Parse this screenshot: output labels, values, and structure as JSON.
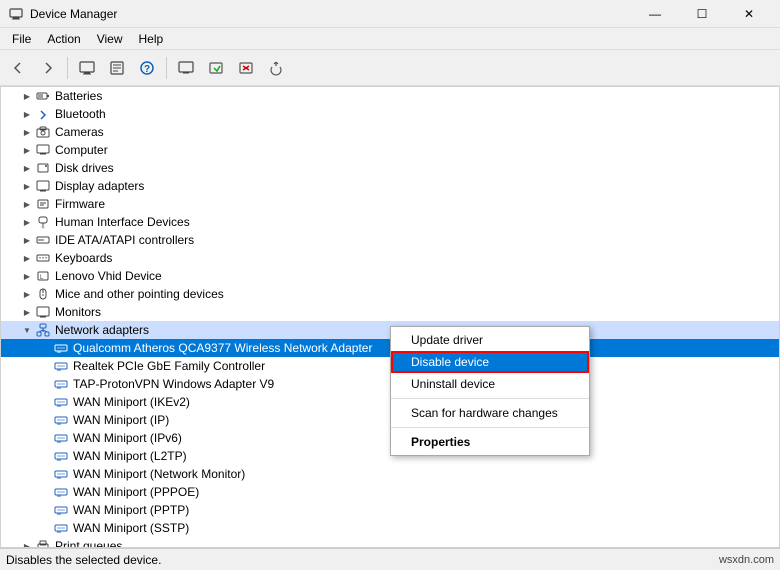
{
  "titleBar": {
    "icon": "🖥",
    "title": "Device Manager",
    "minimize": "—",
    "maximize": "☐",
    "close": "✕"
  },
  "menuBar": {
    "items": [
      "File",
      "Action",
      "View",
      "Help"
    ]
  },
  "toolbar": {
    "buttons": [
      "←",
      "→",
      "🖥",
      "📋",
      "❓",
      "🖥",
      "🔧",
      "✕",
      "⬇"
    ]
  },
  "tree": {
    "items": [
      {
        "id": "batteries",
        "label": "Batteries",
        "indent": 1,
        "expanded": false,
        "hasChildren": true,
        "icon": "battery"
      },
      {
        "id": "bluetooth",
        "label": "Bluetooth",
        "indent": 1,
        "expanded": false,
        "hasChildren": true,
        "icon": "bluetooth"
      },
      {
        "id": "cameras",
        "label": "Cameras",
        "indent": 1,
        "expanded": false,
        "hasChildren": true,
        "icon": "camera"
      },
      {
        "id": "computer",
        "label": "Computer",
        "indent": 1,
        "expanded": false,
        "hasChildren": true,
        "icon": "computer"
      },
      {
        "id": "diskdrives",
        "label": "Disk drives",
        "indent": 1,
        "expanded": false,
        "hasChildren": true,
        "icon": "disk"
      },
      {
        "id": "displayadapters",
        "label": "Display adapters",
        "indent": 1,
        "expanded": false,
        "hasChildren": true,
        "icon": "display"
      },
      {
        "id": "firmware",
        "label": "Firmware",
        "indent": 1,
        "expanded": false,
        "hasChildren": true,
        "icon": "firmware"
      },
      {
        "id": "hid",
        "label": "Human Interface Devices",
        "indent": 1,
        "expanded": false,
        "hasChildren": true,
        "icon": "hid"
      },
      {
        "id": "ide",
        "label": "IDE ATA/ATAPI controllers",
        "indent": 1,
        "expanded": false,
        "hasChildren": true,
        "icon": "ide"
      },
      {
        "id": "keyboards",
        "label": "Keyboards",
        "indent": 1,
        "expanded": false,
        "hasChildren": true,
        "icon": "keyboard"
      },
      {
        "id": "lenovo",
        "label": "Lenovo Vhid Device",
        "indent": 1,
        "expanded": false,
        "hasChildren": true,
        "icon": "lenovo"
      },
      {
        "id": "mice",
        "label": "Mice and other pointing devices",
        "indent": 1,
        "expanded": false,
        "hasChildren": true,
        "icon": "mice"
      },
      {
        "id": "monitors",
        "label": "Monitors",
        "indent": 1,
        "expanded": false,
        "hasChildren": true,
        "icon": "monitor"
      },
      {
        "id": "networkadapters",
        "label": "Network adapters",
        "indent": 1,
        "expanded": true,
        "hasChildren": true,
        "icon": "network",
        "selected": true
      },
      {
        "id": "qualcomm",
        "label": "Qualcomm Atheros QCA9377 Wireless Network Adapter",
        "indent": 2,
        "expanded": false,
        "hasChildren": false,
        "icon": "netcard",
        "highlighted": true
      },
      {
        "id": "realtek",
        "label": "Realtek PCIe GbE Family Controller",
        "indent": 2,
        "expanded": false,
        "hasChildren": false,
        "icon": "netcard"
      },
      {
        "id": "tap",
        "label": "TAP-ProtonVPN Windows Adapter V9",
        "indent": 2,
        "expanded": false,
        "hasChildren": false,
        "icon": "netcard"
      },
      {
        "id": "wan-ikev2",
        "label": "WAN Miniport (IKEv2)",
        "indent": 2,
        "expanded": false,
        "hasChildren": false,
        "icon": "netcard"
      },
      {
        "id": "wan-ip",
        "label": "WAN Miniport (IP)",
        "indent": 2,
        "expanded": false,
        "hasChildren": false,
        "icon": "netcard"
      },
      {
        "id": "wan-ipv6",
        "label": "WAN Miniport (IPv6)",
        "indent": 2,
        "expanded": false,
        "hasChildren": false,
        "icon": "netcard"
      },
      {
        "id": "wan-l2tp",
        "label": "WAN Miniport (L2TP)",
        "indent": 2,
        "expanded": false,
        "hasChildren": false,
        "icon": "netcard"
      },
      {
        "id": "wan-netmon",
        "label": "WAN Miniport (Network Monitor)",
        "indent": 2,
        "expanded": false,
        "hasChildren": false,
        "icon": "netcard"
      },
      {
        "id": "wan-pppoe",
        "label": "WAN Miniport (PPPOE)",
        "indent": 2,
        "expanded": false,
        "hasChildren": false,
        "icon": "netcard"
      },
      {
        "id": "wan-pptp",
        "label": "WAN Miniport (PPTP)",
        "indent": 2,
        "expanded": false,
        "hasChildren": false,
        "icon": "netcard"
      },
      {
        "id": "wan-sstp",
        "label": "WAN Miniport (SSTP)",
        "indent": 2,
        "expanded": false,
        "hasChildren": false,
        "icon": "netcard"
      },
      {
        "id": "printqueues",
        "label": "Print queues",
        "indent": 1,
        "expanded": false,
        "hasChildren": true,
        "icon": "print"
      }
    ]
  },
  "contextMenu": {
    "items": [
      {
        "label": "Update driver",
        "type": "item"
      },
      {
        "label": "Disable device",
        "type": "item",
        "active": true
      },
      {
        "label": "Uninstall device",
        "type": "item"
      },
      {
        "type": "separator"
      },
      {
        "label": "Scan for hardware changes",
        "type": "item"
      },
      {
        "type": "separator"
      },
      {
        "label": "Properties",
        "type": "item",
        "bold": true
      }
    ]
  },
  "statusBar": {
    "text": "Disables the selected device.",
    "right": "wsxdn.com"
  }
}
